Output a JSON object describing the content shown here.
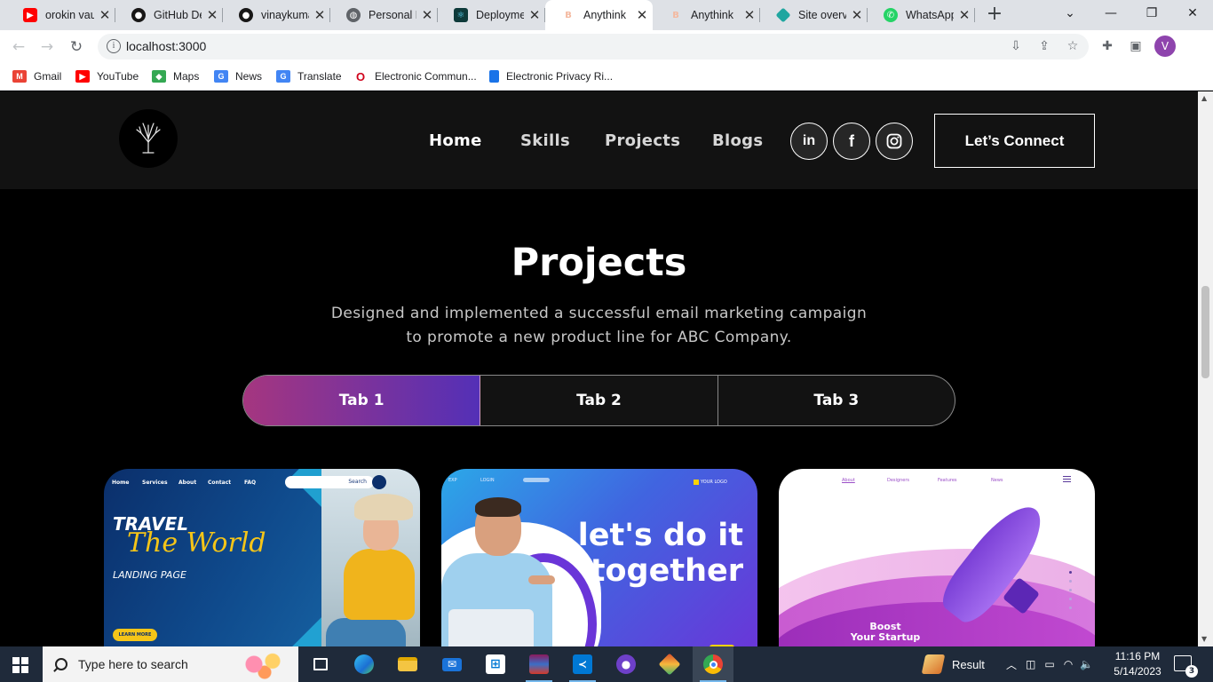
{
  "browser": {
    "tabs": [
      {
        "title": "orokin vau",
        "icon": "youtube-icon",
        "color": "#ff0000",
        "active": false
      },
      {
        "title": "GitHub De",
        "icon": "github-icon",
        "color": "#181717",
        "active": false
      },
      {
        "title": "vinaykuma",
        "icon": "github-icon",
        "color": "#181717",
        "active": false
      },
      {
        "title": "Personal P",
        "icon": "globe-icon",
        "color": "#5f6368",
        "active": false
      },
      {
        "title": "Deploymen",
        "icon": "react-icon",
        "color": "#0e3a3a",
        "active": false
      },
      {
        "title": "Anythink",
        "icon": "anythink-icon",
        "color": "#f4b9a0",
        "active": true
      },
      {
        "title": "Anythink",
        "icon": "anythink-icon",
        "color": "#f4b9a0",
        "active": false
      },
      {
        "title": "Site overvi",
        "icon": "netlify-icon",
        "color": "#20a6a0",
        "active": false
      },
      {
        "title": "WhatsApp",
        "icon": "whatsapp-icon",
        "color": "#25d366",
        "active": false
      }
    ],
    "url": "localhost:3000",
    "profile_initial": "V",
    "bookmarks": [
      {
        "label": "Gmail",
        "icon": "gmail-icon",
        "color": "#ea4335"
      },
      {
        "label": "YouTube",
        "icon": "youtube-icon",
        "color": "#ff0000"
      },
      {
        "label": "Maps",
        "icon": "maps-icon",
        "color": "#34a853"
      },
      {
        "label": "News",
        "icon": "news-icon",
        "color": "#4285f4"
      },
      {
        "label": "Translate",
        "icon": "translate-icon",
        "color": "#4285f4"
      },
      {
        "label": "Electronic Commun...",
        "icon": "opera-icon",
        "color": "#d0021b"
      },
      {
        "label": "Electronic Privacy Ri...",
        "icon": "document-icon",
        "color": "#1a73e8"
      }
    ]
  },
  "site": {
    "nav": {
      "links": [
        "Home",
        "Skills",
        "Projects",
        "Blogs"
      ],
      "connect_label": "Let’s Connect"
    },
    "projects": {
      "title": "Projects",
      "description_line1": "Designed and implemented a successful email marketing campaign",
      "description_line2": "to promote a new product line for ABC Company.",
      "tabs": [
        "Tab 1",
        "Tab 2",
        "Tab 3"
      ],
      "active_tab": "Tab 1"
    },
    "cards": {
      "travel": {
        "nav": [
          "Home",
          "Services",
          "About",
          "Contact",
          "FAQ"
        ],
        "search": "Search",
        "headline1": "TRAVEL",
        "headline2": "The World",
        "subtitle": "LANDING PAGE",
        "button": "LEARN MORE"
      },
      "together": {
        "top_links": [
          "EXP",
          "LOGIN"
        ],
        "logo_text": "YOUR LOGO",
        "headline_line1": "let's do it",
        "headline_line2": "together"
      },
      "startup": {
        "nav": [
          "About",
          "Designers",
          "Features",
          "News"
        ],
        "headline_line1": "Boost",
        "headline_line2": "Your Startup"
      }
    }
  },
  "taskbar": {
    "search_placeholder": "Type here to search",
    "apps": [
      "task-view-icon",
      "edge-icon",
      "file-explorer-icon",
      "mail-icon",
      "store-icon",
      "winrar-icon",
      "vscode-icon",
      "github-desktop-icon",
      "git-icon",
      "chrome-icon"
    ],
    "tray_app_label": "Result",
    "time": "11:16 PM",
    "date": "5/14/2023",
    "notification_count": "3"
  },
  "colors": {
    "tab_gradient_start": "#aa367c",
    "tab_gradient_end": "#4a2fbd",
    "nav_bg": "#121212",
    "page_bg": "#000000"
  }
}
